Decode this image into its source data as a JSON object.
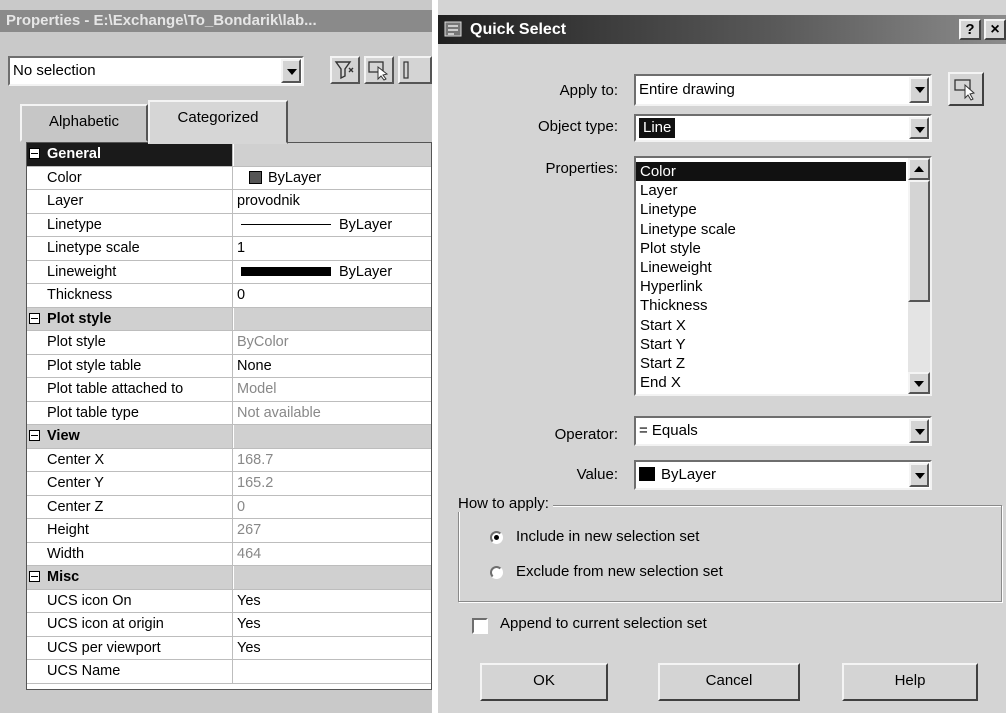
{
  "properties_panel": {
    "title": "Properties - E:\\Exchange\\To_Bondarik\\lab...",
    "selection": "No selection",
    "tabs": [
      {
        "label": "Alphabetic",
        "active": false
      },
      {
        "label": "Categorized",
        "active": true
      }
    ],
    "rows": [
      {
        "category": true,
        "name": "General",
        "value": ""
      },
      {
        "name": "Color",
        "value": "ByLayer",
        "swatch": "#555555"
      },
      {
        "name": "Layer",
        "value": "provodnik"
      },
      {
        "name": "Linetype",
        "value": "ByLayer",
        "line": "thin"
      },
      {
        "name": "Linetype scale",
        "value": "1"
      },
      {
        "name": "Lineweight",
        "value": "ByLayer",
        "line": "thick"
      },
      {
        "name": "Thickness",
        "value": "0"
      },
      {
        "category": true,
        "name": "Plot style",
        "value": ""
      },
      {
        "name": "Plot style",
        "value": "ByColor",
        "disabled": true
      },
      {
        "name": "Plot style table",
        "value": "None"
      },
      {
        "name": "Plot table attached to",
        "value": "Model",
        "disabled": true
      },
      {
        "name": "Plot table type",
        "value": "Not available",
        "disabled": true
      },
      {
        "category": true,
        "name": "View",
        "value": ""
      },
      {
        "name": "Center X",
        "value": "168.7",
        "disabled": true
      },
      {
        "name": "Center Y",
        "value": "165.2",
        "disabled": true
      },
      {
        "name": "Center Z",
        "value": "0",
        "disabled": true
      },
      {
        "name": "Height",
        "value": "267",
        "disabled": true
      },
      {
        "name": "Width",
        "value": "464",
        "disabled": true
      },
      {
        "category": true,
        "name": "Misc",
        "value": ""
      },
      {
        "name": "UCS icon On",
        "value": "Yes"
      },
      {
        "name": "UCS icon at origin",
        "value": "Yes"
      },
      {
        "name": "UCS per viewport",
        "value": "Yes"
      },
      {
        "name": "UCS Name",
        "value": ""
      }
    ]
  },
  "quick_select": {
    "title": "Quick Select",
    "help_glyph": "?",
    "close_glyph": "×",
    "apply_to": {
      "label": "Apply to:",
      "value": "Entire drawing"
    },
    "object_type": {
      "label": "Object type:",
      "value": "Line"
    },
    "properties": {
      "label": "Properties:",
      "items": [
        "Color",
        "Layer",
        "Linetype",
        "Linetype scale",
        "Plot style",
        "Lineweight",
        "Hyperlink",
        "Thickness",
        "Start X",
        "Start Y",
        "Start Z",
        "End X"
      ],
      "selected": "Color"
    },
    "operator": {
      "label": "Operator:",
      "value": "= Equals"
    },
    "value": {
      "label": "Value:",
      "value": "ByLayer",
      "swatch": "#000000"
    },
    "how_to_apply": {
      "label": "How to apply:",
      "options": [
        {
          "label": "Include in new selection set",
          "selected": true
        },
        {
          "label": "Exclude from new selection set",
          "selected": false
        }
      ]
    },
    "append": {
      "label": "Append to current selection set",
      "checked": false
    },
    "buttons": {
      "ok": "OK",
      "cancel": "Cancel",
      "help": "Help"
    }
  }
}
